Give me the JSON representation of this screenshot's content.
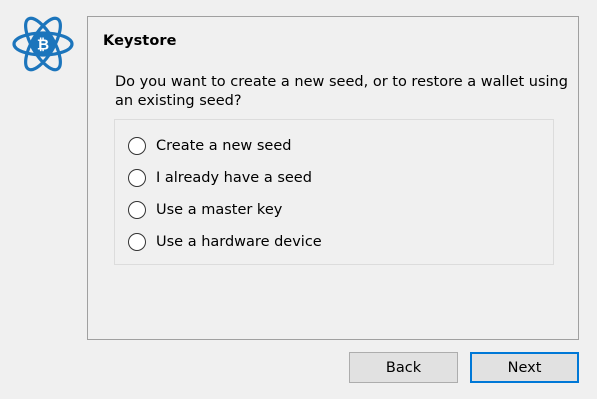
{
  "app": {
    "logo_icon": "electrum-bitcoin-logo-icon",
    "accent_color": "#1c75bc"
  },
  "wizard": {
    "title": "Keystore",
    "question": "Do you want to create a new seed, or to restore a wallet using an existing seed?",
    "options": [
      {
        "label": "Create a new seed",
        "selected": false
      },
      {
        "label": "I already have a seed",
        "selected": false
      },
      {
        "label": "Use a master key",
        "selected": false
      },
      {
        "label": "Use a hardware device",
        "selected": false
      }
    ]
  },
  "buttons": {
    "back_label": "Back",
    "next_label": "Next"
  }
}
